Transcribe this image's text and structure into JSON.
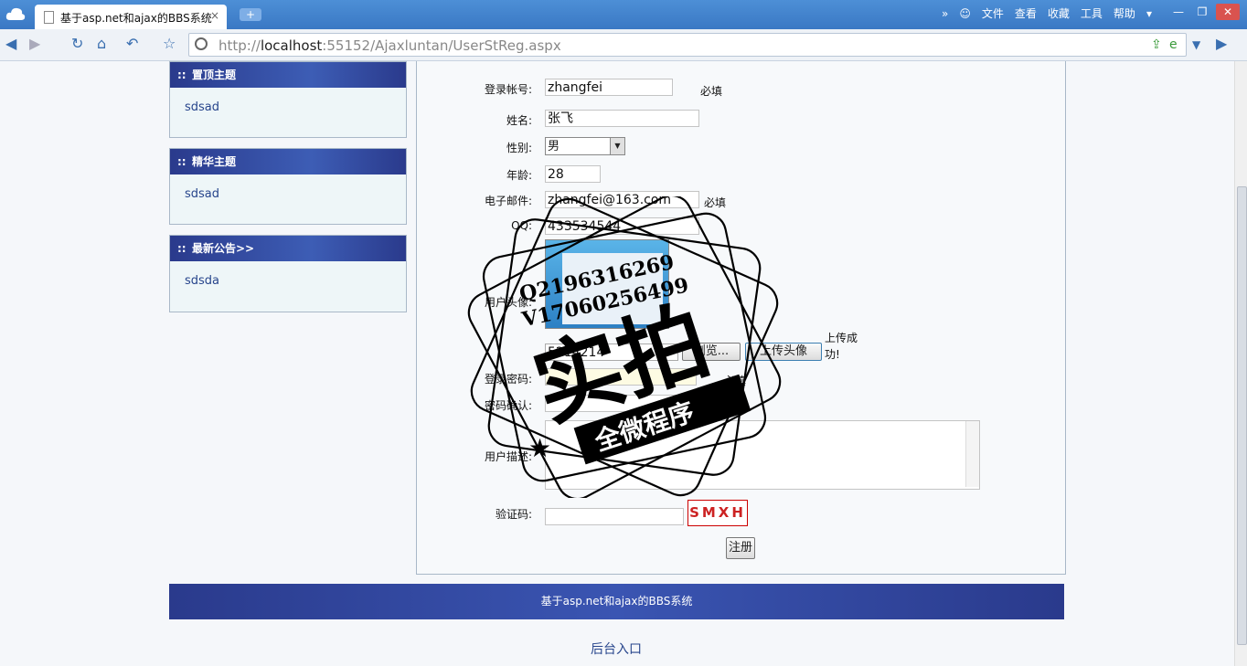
{
  "browser": {
    "tab_title": "基于asp.net和ajax的BBS系统",
    "tab_close": "×",
    "new_tab": "+",
    "url_prefix": "http://",
    "url_host": "localhost",
    "url_rest": ":55152/Ajaxluntan/UserStReg.aspx",
    "menu": [
      "文件",
      "查看",
      "收藏",
      "工具",
      "帮助"
    ]
  },
  "sidebar": {
    "boxes": [
      {
        "title": "置顶主题",
        "item": "sdsad"
      },
      {
        "title": "精华主题",
        "item": "sdsad"
      },
      {
        "title": "最新公告>>",
        "item": "sdsda"
      }
    ]
  },
  "form": {
    "account_label": "登录帐号:",
    "account_value": "zhangfei",
    "required": "必填",
    "name_label": "姓名:",
    "name_value": "张飞",
    "gender_label": "性别:",
    "gender_value": "男",
    "age_label": "年龄:",
    "age_value": "28",
    "email_label": "电子邮件:",
    "email_value": "zhangfei@163.com",
    "qq_label": "QQ:",
    "qq_value": "433534544",
    "avatar_label": "用户头像:",
    "file_value": "5214214",
    "browse_button": "浏览...",
    "upload_button": "上传头像",
    "upload_status": "上传成功!",
    "password_label": "登录密码:",
    "confirm_label": "密码确认:",
    "desc_label": "用户描述:",
    "captcha_label": "验证码:",
    "captcha_text": "SMXH",
    "submit_button": "注册"
  },
  "footer": {
    "text": "基于asp.net和ajax的BBS系统",
    "admin_link": "后台入口"
  },
  "watermark": {
    "line1": "Q2196316269",
    "line2": "V17060256499",
    "main": "实拍",
    "banner": "全微程序"
  }
}
